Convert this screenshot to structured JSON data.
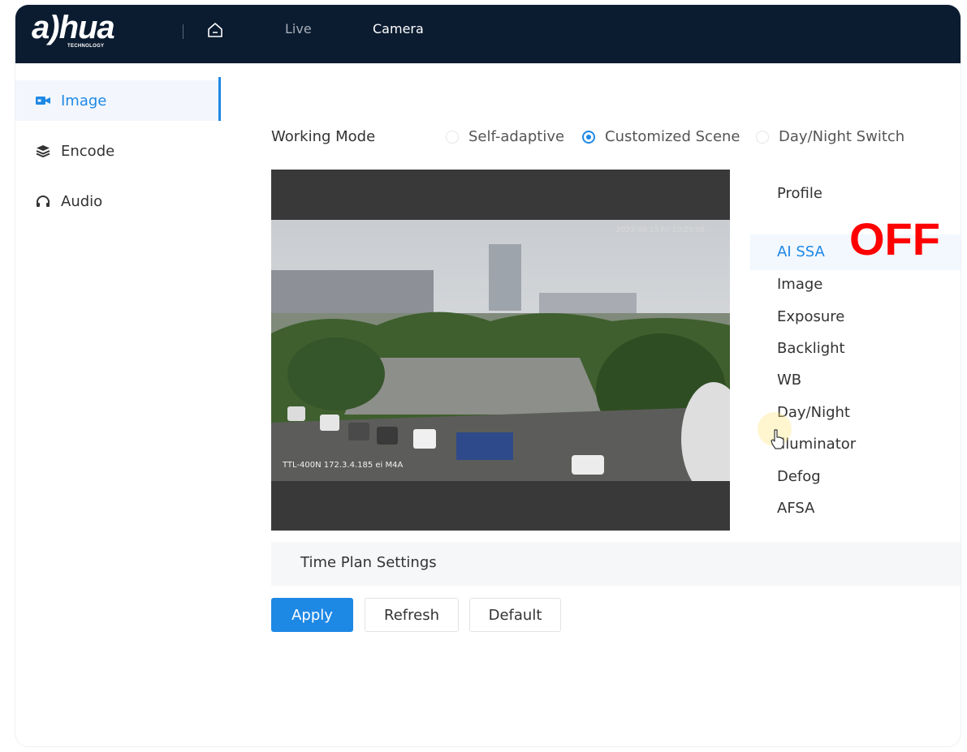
{
  "header": {
    "logo_text": "a)hua",
    "logo_sub": "TECHNOLOGY",
    "nav": {
      "live": "Live",
      "camera": "Camera"
    }
  },
  "sidebar": {
    "items": [
      {
        "label": "Image",
        "icon": "camera-icon",
        "active": true
      },
      {
        "label": "Encode",
        "icon": "layers-icon",
        "active": false
      },
      {
        "label": "Audio",
        "icon": "headphones-icon",
        "active": false
      }
    ]
  },
  "working_mode": {
    "label": "Working Mode",
    "options": [
      "Self-adaptive",
      "Customized Scene",
      "Day/Night Switch"
    ],
    "selected": "Customized Scene"
  },
  "video": {
    "osd_top": "2023-09-15 Fri 10:25:08",
    "osd_bottom": "TTL-400N 172.3.4.185 ei M4A"
  },
  "settings_menu": {
    "profile": "Profile",
    "items": [
      "AI SSA",
      "Image",
      "Exposure",
      "Backlight",
      "WB",
      "Day/Night",
      "Illuminator",
      "Defog",
      "AFSA"
    ],
    "selected": "AI SSA"
  },
  "overlay_status": "OFF",
  "time_plan": {
    "label": "Time Plan Settings"
  },
  "buttons": {
    "apply": "Apply",
    "refresh": "Refresh",
    "default": "Default"
  },
  "colors": {
    "accent": "#1e88e5",
    "topbar": "#0b1b30",
    "overlay": "#ff0000"
  }
}
